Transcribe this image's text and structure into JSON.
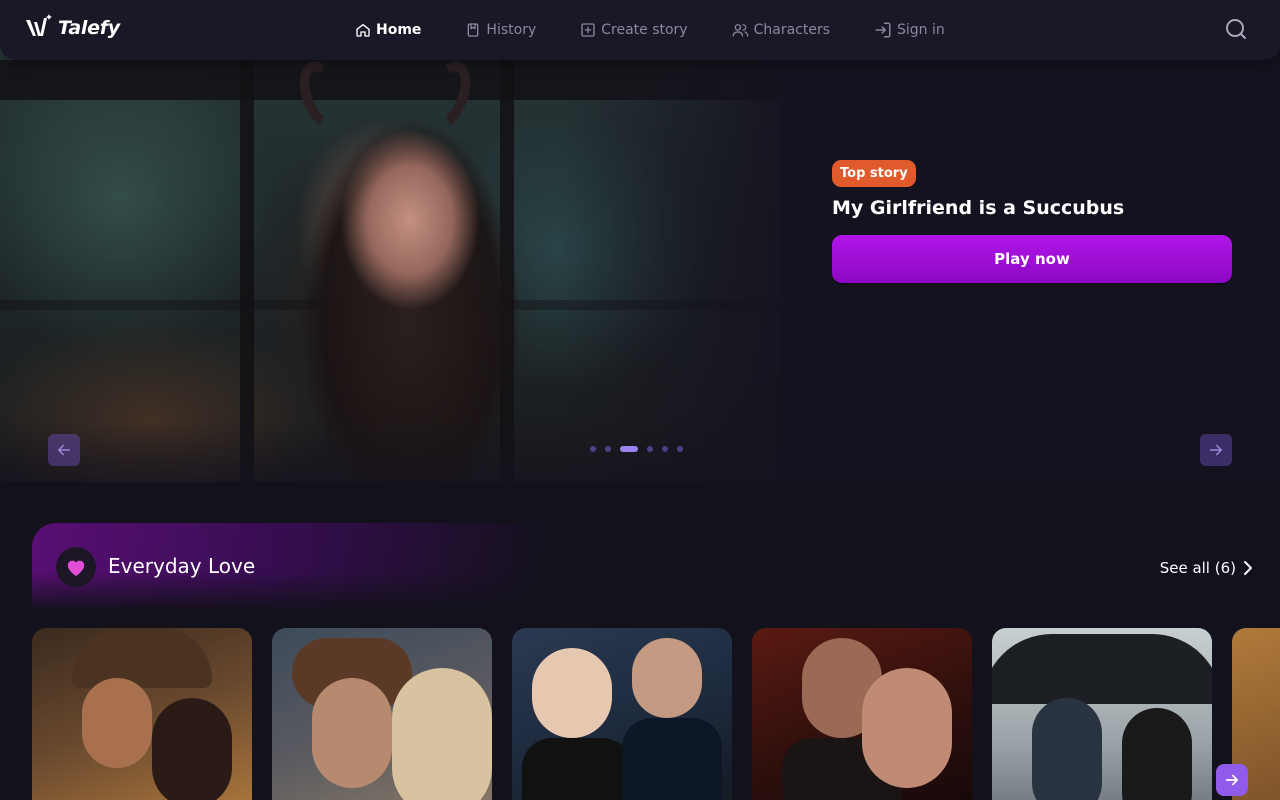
{
  "brand": {
    "name": "Talefy"
  },
  "nav": {
    "items": [
      {
        "label": "Home",
        "icon": "home-icon",
        "active": true
      },
      {
        "label": "History",
        "icon": "bookmark-icon",
        "active": false
      },
      {
        "label": "Create story",
        "icon": "plus-square-icon",
        "active": false
      },
      {
        "label": "Characters",
        "icon": "users-icon",
        "active": false
      },
      {
        "label": "Sign in",
        "icon": "sign-in-icon",
        "active": false
      }
    ],
    "search_icon": "search-icon"
  },
  "hero": {
    "badge": "Top story",
    "title": "My Girlfriend is a Succubus",
    "play_label": "Play now",
    "slide_count": 6,
    "active_slide": 3
  },
  "section": {
    "title": "Everyday Love",
    "icon": "heart-icon",
    "see_all": "See all (6)"
  },
  "cards": [
    {
      "name": "card-1"
    },
    {
      "name": "card-2"
    },
    {
      "name": "card-3"
    },
    {
      "name": "card-4"
    },
    {
      "name": "card-5"
    },
    {
      "name": "card-6"
    }
  ],
  "colors": {
    "background": "#13111c",
    "nav": "#1a1726",
    "accent_purple": "#a012dd",
    "badge_orange": "#e05a2b",
    "heart_pink": "#e04fd6",
    "arrow_purple": "#8f5be8"
  }
}
